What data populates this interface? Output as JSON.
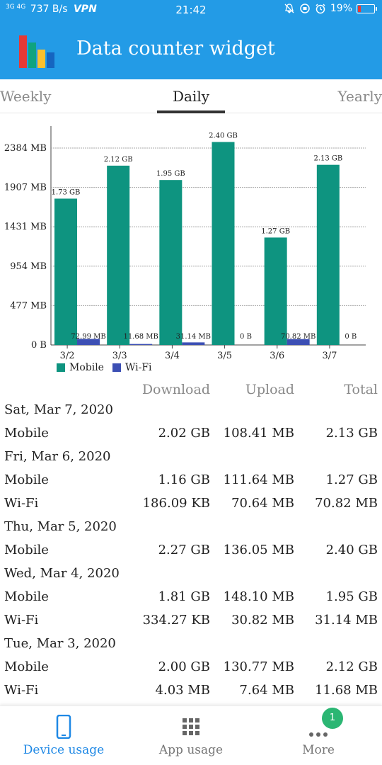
{
  "status_bar": {
    "signal_text": "3G 4G",
    "speed": "737 B/s",
    "vpn": "VPN",
    "time": "21:42",
    "battery": "19%",
    "battery_level": 0.19,
    "icons": [
      "signal-icon",
      "silent-icon",
      "data-saver-icon",
      "alarm-icon",
      "battery-icon"
    ]
  },
  "app": {
    "title": "Data counter widget",
    "logo_icon": "bar-chart-logo-icon"
  },
  "tabs": {
    "items": [
      "Weekly",
      "Daily",
      "Yearly"
    ],
    "selected": "Daily"
  },
  "chart_data": {
    "type": "bar",
    "categories": [
      "3/2",
      "3/3",
      "3/4",
      "3/5",
      "3/6",
      "3/7"
    ],
    "series": [
      {
        "name": "Mobile",
        "color": "#0e9480",
        "values": [
          1771.52,
          2170.88,
          1996.8,
          2457.6,
          1300.48,
          2181.12
        ],
        "labels": [
          "1.73 GB",
          "2.12 GB",
          "1.95 GB",
          "2.40 GB",
          "1.27 GB",
          "2.13 GB"
        ]
      },
      {
        "name": "Wi-Fi",
        "color": "#3c4fb4",
        "values": [
          72.99,
          11.68,
          31.14,
          0,
          70.82,
          0
        ],
        "labels": [
          "72.99 MB",
          "11.68 MB",
          "31.14 MB",
          "0 B",
          "70.82 MB",
          "0 B"
        ]
      }
    ],
    "y_ticks": [
      0,
      477,
      954,
      1431,
      1907,
      2384
    ],
    "y_tick_labels": [
      "0 B",
      "477 MB",
      "954 MB",
      "1431 MB",
      "1907 MB",
      "2384 MB"
    ],
    "ylim": [
      0,
      2650
    ],
    "grid": true,
    "legend": "bottom-left",
    "title": "",
    "xlabel": "",
    "ylabel": ""
  },
  "usage": {
    "headers": [
      "Download",
      "Upload",
      "Total"
    ],
    "rows": [
      {
        "type": "date",
        "label": "Sat, Mar 7, 2020"
      },
      {
        "type": "data",
        "label": "Mobile",
        "download": "2.02 GB",
        "upload": "108.41 MB",
        "total": "2.13 GB"
      },
      {
        "type": "date",
        "label": "Fri, Mar 6, 2020"
      },
      {
        "type": "data",
        "label": "Mobile",
        "download": "1.16 GB",
        "upload": "111.64 MB",
        "total": "1.27 GB"
      },
      {
        "type": "data",
        "label": "Wi-Fi",
        "download": "186.09 KB",
        "upload": "70.64 MB",
        "total": "70.82 MB"
      },
      {
        "type": "date",
        "label": "Thu, Mar 5, 2020"
      },
      {
        "type": "data",
        "label": "Mobile",
        "download": "2.27 GB",
        "upload": "136.05 MB",
        "total": "2.40 GB"
      },
      {
        "type": "date",
        "label": "Wed, Mar 4, 2020"
      },
      {
        "type": "data",
        "label": "Mobile",
        "download": "1.81 GB",
        "upload": "148.10 MB",
        "total": "1.95 GB"
      },
      {
        "type": "data",
        "label": "Wi-Fi",
        "download": "334.27 KB",
        "upload": "30.82 MB",
        "total": "31.14 MB"
      },
      {
        "type": "date",
        "label": "Tue, Mar 3, 2020"
      },
      {
        "type": "data",
        "label": "Mobile",
        "download": "2.00 GB",
        "upload": "130.77 MB",
        "total": "2.12 GB"
      },
      {
        "type": "data",
        "label": "Wi-Fi",
        "download": "4.03 MB",
        "upload": "7.64 MB",
        "total": "11.68 MB"
      }
    ]
  },
  "bottom_nav": {
    "items": [
      {
        "label": "Device usage",
        "icon": "phone-icon",
        "active": true
      },
      {
        "label": "App usage",
        "icon": "grid-icon",
        "active": false
      },
      {
        "label": "More",
        "icon": "more-dots-icon",
        "active": false,
        "badge": "1"
      }
    ],
    "active_color": "#1e88e5",
    "badge_color": "#2bb673"
  }
}
